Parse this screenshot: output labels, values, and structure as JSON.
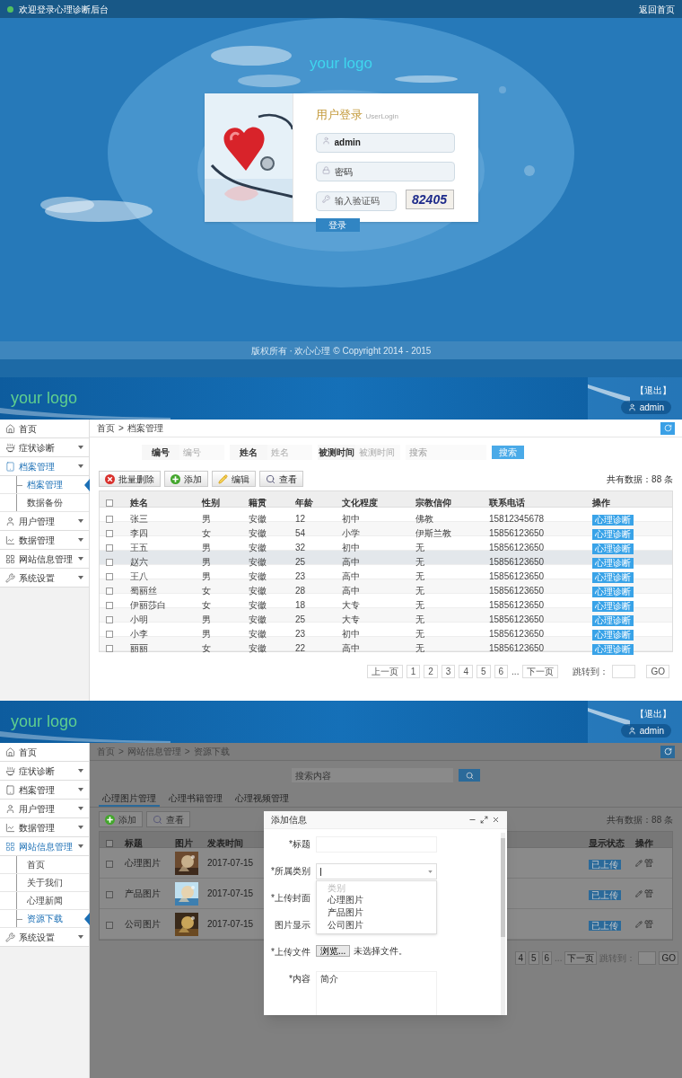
{
  "login_screen": {
    "top_bar": {
      "welcome": "欢迎登录心理诊断后台",
      "home_link": "返回首页"
    },
    "logo": "your logo",
    "login_card": {
      "title": "用户登录",
      "subtitle": "UserLogin",
      "username": {
        "value": "admin"
      },
      "password": {
        "placeholder": "密码"
      },
      "captcha": {
        "placeholder": "输入验证码",
        "code": "82405"
      },
      "submit": "登录"
    },
    "footer": "版权所有 · 欢心心理 © Copyright 2014 - 2015"
  },
  "archive_screen": {
    "header": {
      "logo": "your logo",
      "logout": "【退出】",
      "user": "admin"
    },
    "sidebar": [
      {
        "label": "首页",
        "expandable": false,
        "expanded": false
      },
      {
        "label": "症状诊断",
        "expandable": true,
        "expanded": false
      },
      {
        "label": "档案管理",
        "expandable": true,
        "expanded": true,
        "children": [
          {
            "label": "档案管理",
            "selected": true
          },
          {
            "label": "数据备份",
            "selected": false
          }
        ]
      },
      {
        "label": "用户管理",
        "expandable": true,
        "expanded": false
      },
      {
        "label": "数据管理",
        "expandable": true,
        "expanded": false
      },
      {
        "label": "网站信息管理",
        "expandable": true,
        "expanded": false
      },
      {
        "label": "系统设置",
        "expandable": true,
        "expanded": false
      }
    ],
    "breadcrumb": [
      "首页",
      "档案管理"
    ],
    "breadcrumb_separator": ">",
    "search": {
      "fields": [
        {
          "label": "编号",
          "placeholder": "编号"
        },
        {
          "label": "姓名",
          "placeholder": "姓名"
        },
        {
          "label": "被测时间",
          "placeholder": "被测时间"
        }
      ],
      "keyword_placeholder": "搜索",
      "button": "搜索"
    },
    "toolbar": [
      {
        "kind": "delete",
        "label": "批量删除"
      },
      {
        "kind": "add",
        "label": "添加"
      },
      {
        "kind": "edit",
        "label": "编辑"
      },
      {
        "kind": "view",
        "label": "查看"
      }
    ],
    "total": "共有数据：88 条",
    "table": {
      "all_checked": false,
      "columns": [
        "姓名",
        "性别",
        "籍贯",
        "年龄",
        "文化程度",
        "宗教信仰",
        "联系电话",
        "操作"
      ],
      "rows": [
        {
          "checked": false,
          "selected": false,
          "cells": [
            "张三",
            "男",
            "安徽",
            "12",
            "初中",
            "佛教",
            "15812345678"
          ],
          "action": "心理诊断"
        },
        {
          "checked": false,
          "selected": false,
          "cells": [
            "李四",
            "女",
            "安徽",
            "54",
            "小学",
            "伊斯兰教",
            "15856123650"
          ],
          "action": "心理诊断"
        },
        {
          "checked": false,
          "selected": false,
          "cells": [
            "王五",
            "男",
            "安徽",
            "32",
            "初中",
            "无",
            "15856123650"
          ],
          "action": "心理诊断"
        },
        {
          "checked": false,
          "selected": true,
          "cells": [
            "赵六",
            "男",
            "安徽",
            "25",
            "高中",
            "无",
            "15856123650"
          ],
          "action": "心理诊断"
        },
        {
          "checked": false,
          "selected": false,
          "cells": [
            "王八",
            "男",
            "安徽",
            "23",
            "高中",
            "无",
            "15856123650"
          ],
          "action": "心理诊断"
        },
        {
          "checked": false,
          "selected": false,
          "cells": [
            "蜀丽丝",
            "女",
            "安徽",
            "28",
            "高中",
            "无",
            "15856123650"
          ],
          "action": "心理诊断"
        },
        {
          "checked": false,
          "selected": false,
          "cells": [
            "伊丽莎白",
            "女",
            "安徽",
            "18",
            "大专",
            "无",
            "15856123650"
          ],
          "action": "心理诊断"
        },
        {
          "checked": false,
          "selected": false,
          "cells": [
            "小明",
            "男",
            "安徽",
            "25",
            "大专",
            "无",
            "15856123650"
          ],
          "action": "心理诊断"
        },
        {
          "checked": false,
          "selected": false,
          "cells": [
            "小李",
            "男",
            "安徽",
            "23",
            "初中",
            "无",
            "15856123650"
          ],
          "action": "心理诊断"
        },
        {
          "checked": false,
          "selected": false,
          "cells": [
            "丽丽",
            "女",
            "安徽",
            "22",
            "高中",
            "无",
            "15856123650"
          ],
          "action": "心理诊断"
        }
      ]
    },
    "pagination": {
      "prev": "上一页",
      "pages": [
        "1",
        "2",
        "3",
        "4",
        "5",
        "6"
      ],
      "ellipsis": "...",
      "next": "下一页",
      "jump_label": "跳转到：",
      "go": "GO"
    }
  },
  "resource_screen": {
    "header": {
      "logo": "your logo",
      "logout": "【退出】",
      "user": "admin"
    },
    "sidebar": [
      {
        "label": "首页",
        "expandable": false,
        "expanded": false
      },
      {
        "label": "症状诊断",
        "expandable": true,
        "expanded": false
      },
      {
        "label": "档案管理",
        "expandable": true,
        "expanded": false
      },
      {
        "label": "用户管理",
        "expandable": true,
        "expanded": false
      },
      {
        "label": "数据管理",
        "expandable": true,
        "expanded": false
      },
      {
        "label": "网站信息管理",
        "expandable": true,
        "expanded": true,
        "children": [
          {
            "label": "首页",
            "selected": false
          },
          {
            "label": "关于我们",
            "selected": false
          },
          {
            "label": "心理新闻",
            "selected": false
          },
          {
            "label": "资源下载",
            "selected": true
          }
        ]
      },
      {
        "label": "系统设置",
        "expandable": true,
        "expanded": false
      }
    ],
    "breadcrumb": [
      "首页",
      "网站信息管理",
      "资源下载"
    ],
    "breadcrumb_separator": ">",
    "search": {
      "placeholder": "搜索内容"
    },
    "tabs": [
      {
        "label": "心理图片管理",
        "selected": true
      },
      {
        "label": "心理书籍管理",
        "selected": false
      },
      {
        "label": "心理视频管理",
        "selected": false
      }
    ],
    "toolbar": [
      {
        "kind": "add",
        "label": "添加"
      },
      {
        "kind": "view",
        "label": "查看"
      }
    ],
    "total": "共有数据：88 条",
    "table": {
      "all_checked": false,
      "columns": [
        "标题",
        "图片",
        "发表时间",
        "显示状态",
        "操作"
      ],
      "rows": [
        {
          "checked": false,
          "title": "心理图片",
          "date": "2017-07-15",
          "status": "已上传",
          "action": "管"
        },
        {
          "checked": false,
          "title": "产品图片",
          "date": "2017-07-15",
          "status": "已上传",
          "action": "管"
        },
        {
          "checked": false,
          "title": "公司图片",
          "date": "2017-07-15",
          "status": "已上传",
          "action": "管"
        }
      ]
    },
    "pagination": {
      "pages": [
        "4",
        "5",
        "6"
      ],
      "ellipsis": "...",
      "next": "下一页",
      "jump_label": "跳转到：",
      "go": "GO"
    },
    "modal": {
      "title": "添加信息",
      "fields": [
        {
          "kind": "text",
          "label": "*标题"
        },
        {
          "kind": "select",
          "label": "*所属类别",
          "focused": true,
          "open": true,
          "options_header": "类别",
          "options": [
            "心理图片",
            "产品图片",
            "公司图片"
          ]
        },
        {
          "kind": "covered",
          "label": "*上传封面"
        },
        {
          "kind": "covered",
          "label": "图片显示"
        },
        {
          "kind": "file",
          "label": "*上传文件",
          "button": "浏览...",
          "status": "未选择文件。"
        },
        {
          "kind": "textarea",
          "label": "*内容",
          "value": "简介"
        }
      ]
    }
  }
}
